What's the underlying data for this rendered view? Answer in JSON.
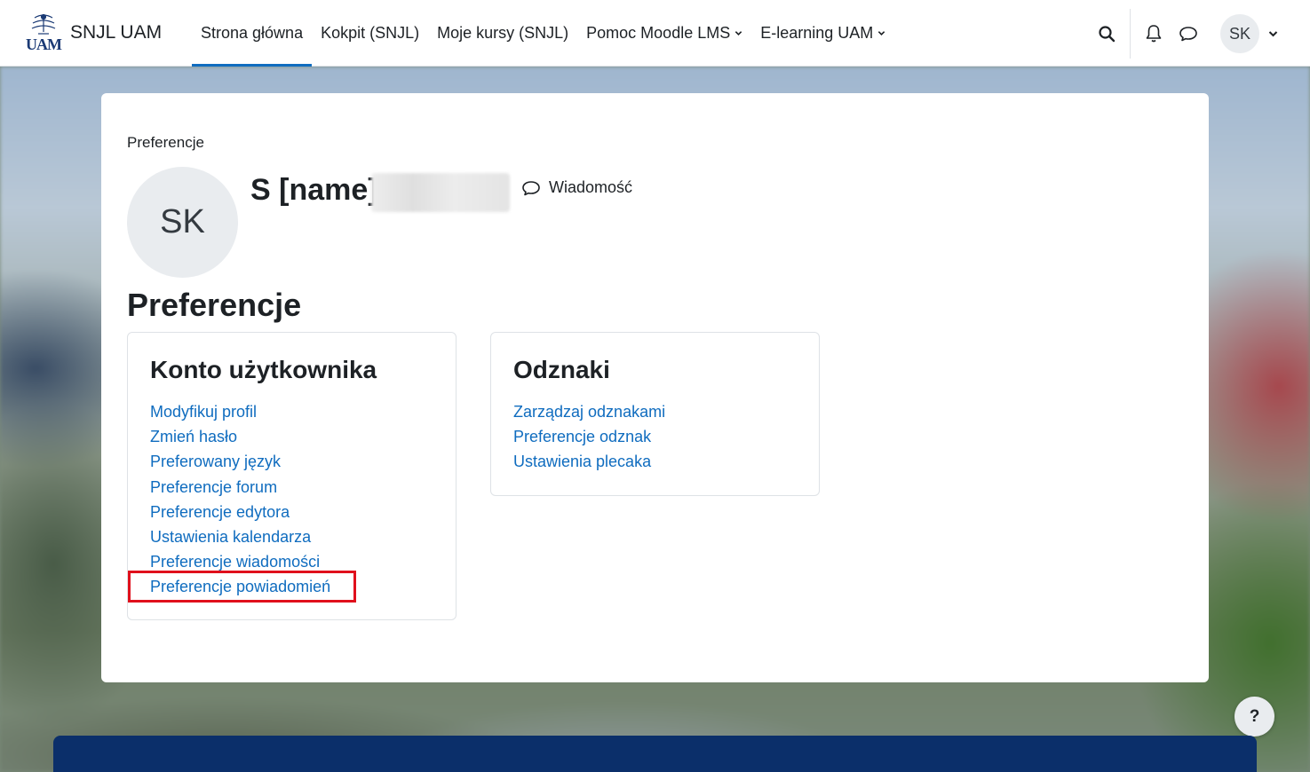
{
  "header": {
    "logo_text": "UAM",
    "site_name": "SNJL UAM",
    "nav": [
      {
        "label": "Strona główna",
        "active": true,
        "dropdown": false
      },
      {
        "label": "Kokpit (SNJL)",
        "active": false,
        "dropdown": false
      },
      {
        "label": "Moje kursy (SNJL)",
        "active": false,
        "dropdown": false
      },
      {
        "label": "Pomoc Moodle LMS",
        "active": false,
        "dropdown": true
      },
      {
        "label": "E-learning UAM",
        "active": false,
        "dropdown": true
      }
    ],
    "icons": [
      "search-icon",
      "bell-icon",
      "chat-icon"
    ],
    "user_initials": "SK"
  },
  "profile": {
    "breadcrumb": "Preferencje",
    "initials": "SK",
    "name_visible": "S           [name]",
    "message_label": "Wiadomość"
  },
  "page_title": "Preferencje",
  "cards": {
    "account": {
      "title": "Konto użytkownika",
      "links": [
        "Modyfikuj profil",
        "Zmień hasło",
        "Preferowany język",
        "Preferencje forum",
        "Preferencje edytora",
        "Ustawienia kalendarza",
        "Preferencje wiadomości",
        "Preferencje powiadomień"
      ]
    },
    "badges": {
      "title": "Odznaki",
      "links": [
        "Zarządzaj odznakami",
        "Preferencje odznak",
        "Ustawienia plecaka"
      ]
    }
  },
  "help_label": "?",
  "colors": {
    "link": "#0f6cbf",
    "active_tab": "#0f6cbf",
    "highlight": "#e0101c",
    "footer": "#0b2f6a"
  }
}
